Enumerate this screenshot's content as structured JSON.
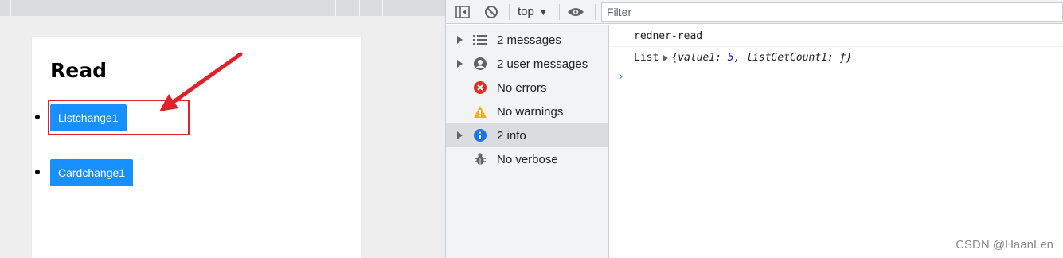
{
  "page": {
    "title": "Read",
    "buttons": [
      {
        "label": "Listchange1"
      },
      {
        "label": "Cardchange1"
      }
    ],
    "annotation_color": "#e0202a",
    "button_color": "#1890ff"
  },
  "devtools": {
    "context": {
      "label": "top"
    },
    "filter": {
      "placeholder": "Filter"
    },
    "sidebar": {
      "items": [
        {
          "label": "2 messages",
          "icon": "list-icon",
          "expandable": true
        },
        {
          "label": "2 user messages",
          "icon": "user-icon",
          "expandable": true
        },
        {
          "label": "No errors",
          "icon": "error-icon",
          "expandable": false
        },
        {
          "label": "No warnings",
          "icon": "warning-icon",
          "expandable": false
        },
        {
          "label": "2 info",
          "icon": "info-icon",
          "expandable": true,
          "selected": true
        },
        {
          "label": "No verbose",
          "icon": "bug-icon",
          "expandable": false
        }
      ]
    },
    "console": {
      "logs": [
        {
          "text": "redner-read"
        },
        {
          "prefix": "List",
          "object": {
            "k1": "value1",
            "v1": "5",
            "k2": "listGetCount1",
            "v2": "ƒ"
          }
        }
      ],
      "prompt": "›"
    }
  },
  "watermark": "CSDN @HaanLen"
}
